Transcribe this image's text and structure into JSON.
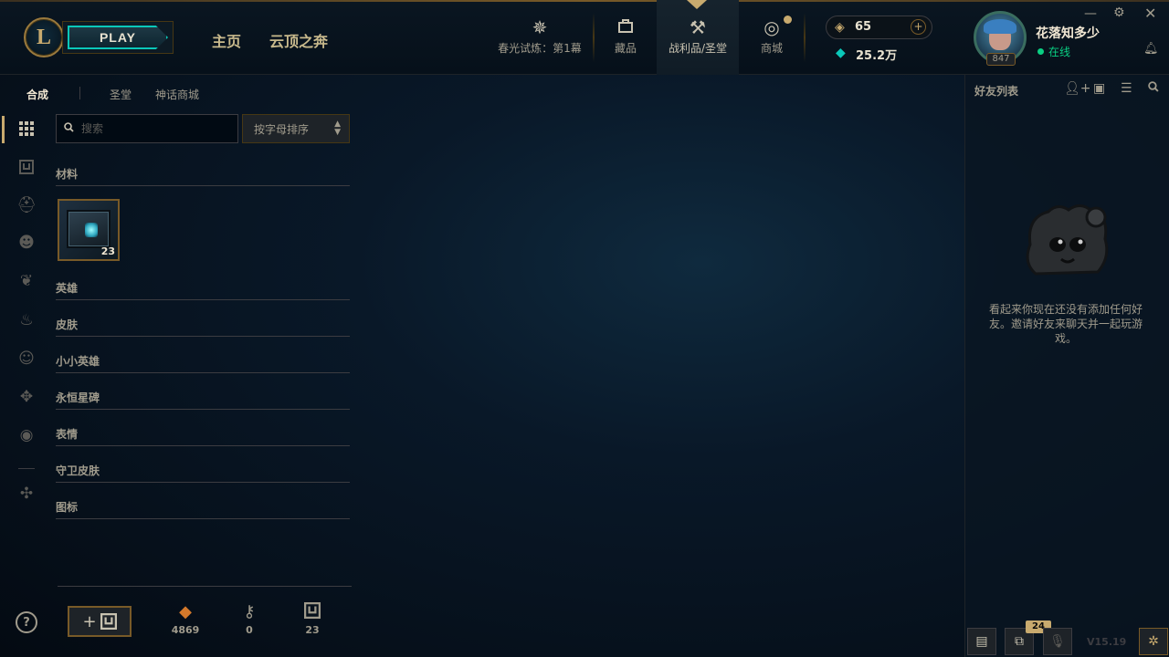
{
  "topbar": {
    "logo_glyph": "L",
    "play_label": "PLAY",
    "nav_home": "主页",
    "nav_tft": "云顶之奔",
    "tabs": [
      {
        "label": "春光试炼：第1幕",
        "icon": "event-pass-icon"
      },
      {
        "label": "藏品",
        "icon": "collection-icon"
      },
      {
        "label": "战利品/圣堂",
        "icon": "loot-icon"
      },
      {
        "label": "商城",
        "icon": "store-icon"
      }
    ],
    "currency_rp": "65",
    "currency_be": "25.2万",
    "player_name": "花落知多少",
    "player_status": "在线",
    "player_level": "847"
  },
  "loot": {
    "subtabs": [
      "合成",
      "圣堂",
      "神话商城"
    ],
    "search_placeholder": "搜索",
    "sort_label": "按字母排序",
    "categories": {
      "materials": "材料",
      "champions": "英雄",
      "skins": "皮肤",
      "little_legends": "小小英雄",
      "eternals": "永恒星碑",
      "emotes": "表情",
      "ward_skins": "守卫皮肤",
      "icons": "图标"
    },
    "material_item": {
      "name": "hextech-chest",
      "count": "23"
    },
    "resources": {
      "orange_essence": "4869",
      "keys": "0",
      "chests": "23"
    }
  },
  "friends": {
    "title": "好友列表",
    "empty_message": "看起来你现在还没有添加任何好友。邀请好友来聊天并一起玩游戏。",
    "notification_count": "24",
    "version": "V15.19"
  },
  "colors": {
    "gold": "#c8aa6e",
    "teal": "#0ac8b9",
    "online": "#0acf83",
    "panel_bg": "#06101b"
  }
}
